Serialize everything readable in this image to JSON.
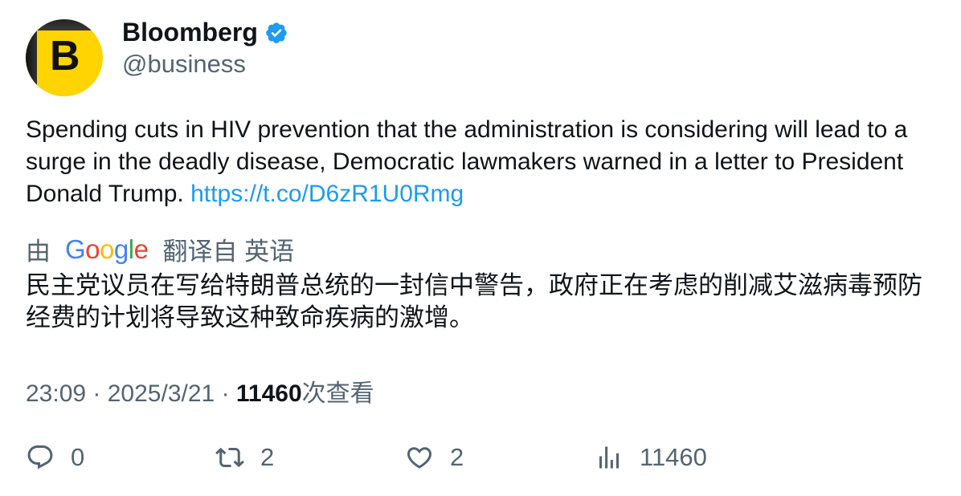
{
  "author": {
    "name": "Bloomberg",
    "handle": "@business",
    "avatar_letter": "B",
    "verified": true
  },
  "tweet": {
    "text": "Spending cuts in HIV prevention that the administration is considering will lead to a surge in the deadly disease, Democratic lawmakers warned in a letter to President Donald Trump.",
    "link": "https://t.co/D6zR1U0Rmg"
  },
  "translation": {
    "prefix": "由",
    "provider": "Google",
    "suffix": "翻译自 英语",
    "text": "民主党议员在写给特朗普总统的一封信中警告，政府正在考虑的削减艾滋病毒预防经费的计划将导致这种致命疾病的激增。"
  },
  "meta": {
    "time": "23:09",
    "date": "2025/3/21",
    "views": "11460",
    "views_label": "次查看"
  },
  "actions": {
    "replies": "0",
    "retweets": "2",
    "likes": "2",
    "views": "11460"
  },
  "colors": {
    "link": "#1d9bf0",
    "secondary": "#536471",
    "avatar_bg": "#ffd400"
  }
}
